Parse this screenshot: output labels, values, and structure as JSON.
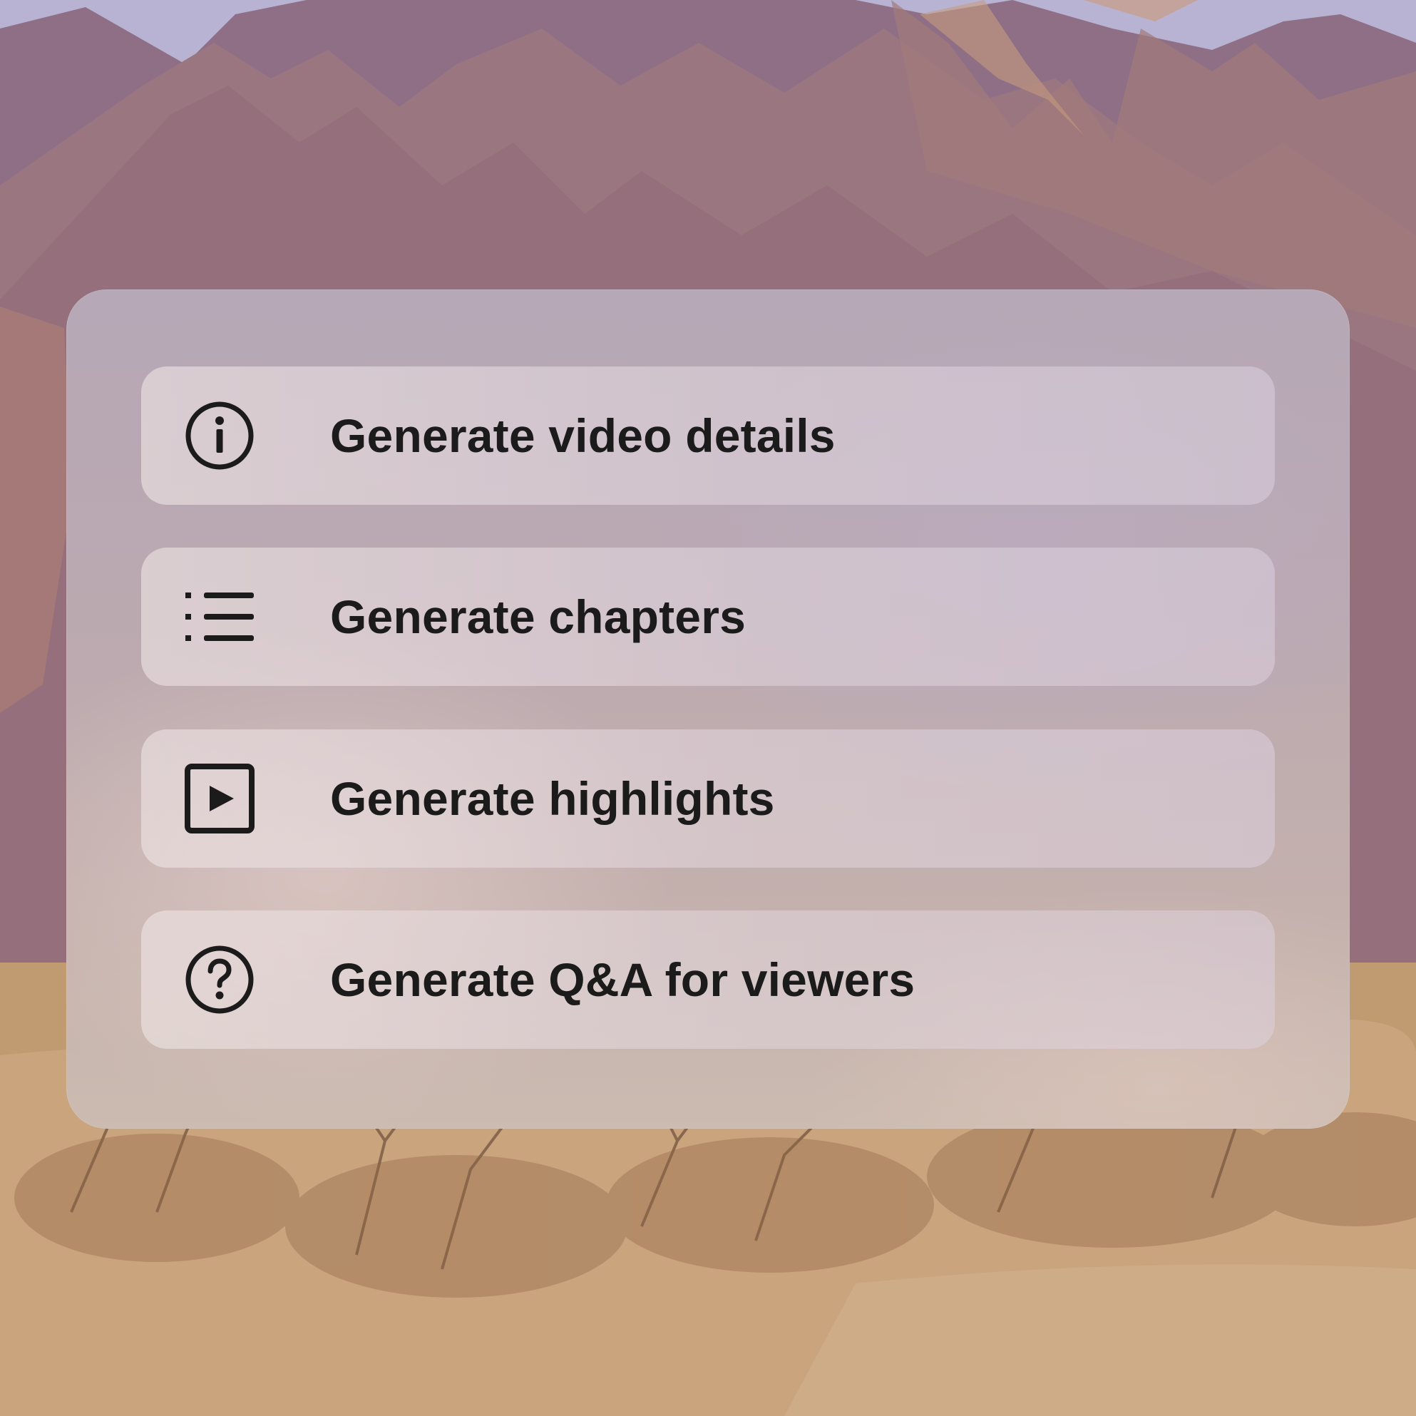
{
  "menu": {
    "items": [
      {
        "label": "Generate video details",
        "icon": "info-icon"
      },
      {
        "label": "Generate chapters",
        "icon": "list-icon"
      },
      {
        "label": "Generate highlights",
        "icon": "play-square-icon"
      },
      {
        "label": "Generate Q&A for viewers",
        "icon": "question-circle-icon"
      }
    ]
  },
  "colors": {
    "text": "#1b1b1b",
    "icon": "#1b1b1b"
  }
}
